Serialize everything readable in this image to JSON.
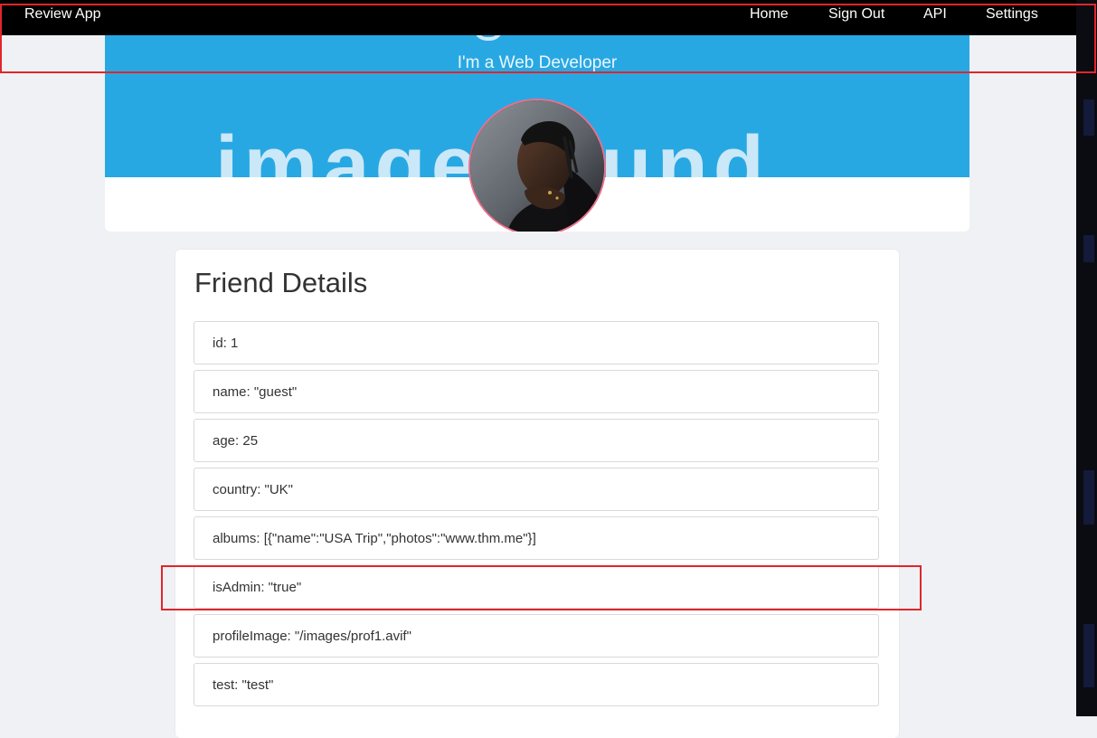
{
  "navbar": {
    "brand": "Review App",
    "links": [
      "Home",
      "Sign Out",
      "API",
      "Settings"
    ]
  },
  "header": {
    "subtitle": "I'm a Web Developer",
    "banner_image_text": "image    found"
  },
  "details": {
    "title": "Friend Details",
    "items": [
      "id: 1",
      "name: \"guest\"",
      "age: 25",
      "country: \"UK\"",
      "albums: [{\"name\":\"USA Trip\",\"photos\":\"www.thm.me\"}]",
      "isAdmin: \"true\"",
      "profileImage: \"/images/prof1.avif\"",
      "test: \"test\""
    ]
  },
  "colors": {
    "navbar_bg": "#000000",
    "banner_bg": "#28a8e3",
    "page_bg": "#f0f1f5",
    "highlight": "#e0262b",
    "avatar_border": "#e8718b"
  }
}
